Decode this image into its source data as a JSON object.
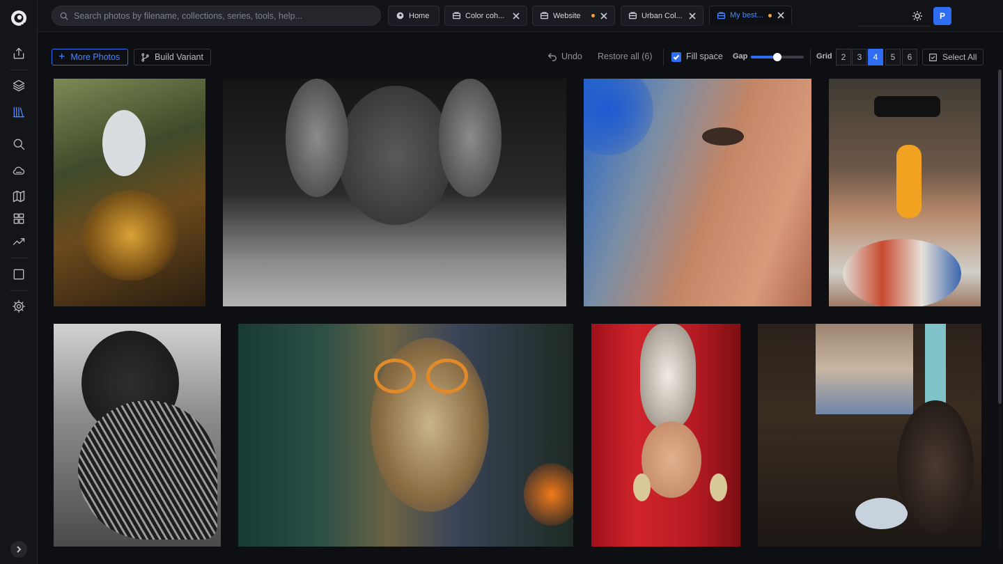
{
  "search": {
    "placeholder": "Search photos by filename, collections, series, tools, help..."
  },
  "tabs": [
    {
      "label": "Home",
      "icon": "palette-icon",
      "closable": false,
      "active": false
    },
    {
      "label": "Color coh...",
      "icon": "collection-icon",
      "closable": true,
      "modified": false,
      "active": false
    },
    {
      "label": "Website",
      "icon": "collection-icon",
      "closable": true,
      "modified": true,
      "active": false
    },
    {
      "label": "Urban Col...",
      "icon": "collection-icon",
      "closable": true,
      "modified": false,
      "active": false
    },
    {
      "label": "My best...",
      "icon": "collection-icon",
      "closable": true,
      "modified": true,
      "active": true
    }
  ],
  "user": {
    "avatar_letter": "P"
  },
  "toolbar": {
    "more_photos": "More Photos",
    "build_variant": "Build Variant",
    "undo": "Undo",
    "restore_all": "Restore all (6)",
    "fill_space": "Fill space",
    "fill_space_checked": true,
    "gap_label": "Gap",
    "gap_value_fraction": 0.5,
    "grid_label": "Grid",
    "grid_options": [
      "2",
      "3",
      "4",
      "5",
      "6"
    ],
    "grid_selected": "4",
    "select_all": "Select All"
  },
  "sidebar": {
    "items": [
      {
        "name": "upload-icon"
      },
      {
        "name": "layers-icon"
      },
      {
        "name": "library-icon",
        "active": true
      },
      {
        "name": "search-icon"
      },
      {
        "name": "cloud-icon"
      },
      {
        "name": "map-icon"
      },
      {
        "name": "dashboard-icon"
      },
      {
        "name": "trend-icon"
      },
      {
        "name": "square-icon"
      },
      {
        "name": "settings-icon"
      }
    ]
  },
  "colors": {
    "accent": "#2f6ef2",
    "modified_dot": "#f2a33a",
    "background": "#0e0f12"
  },
  "photos": [
    {
      "name": "photo-mona-lisa-collage"
    },
    {
      "name": "photo-girl-hands-face-bw"
    },
    {
      "name": "photo-man-face-water"
    },
    {
      "name": "photo-woman-sunglasses-popsicle"
    },
    {
      "name": "photo-woman-fan-bw"
    },
    {
      "name": "photo-woman-orange-glasses"
    },
    {
      "name": "photo-drag-queen-headdress"
    },
    {
      "name": "photo-window-wine-scene"
    }
  ]
}
